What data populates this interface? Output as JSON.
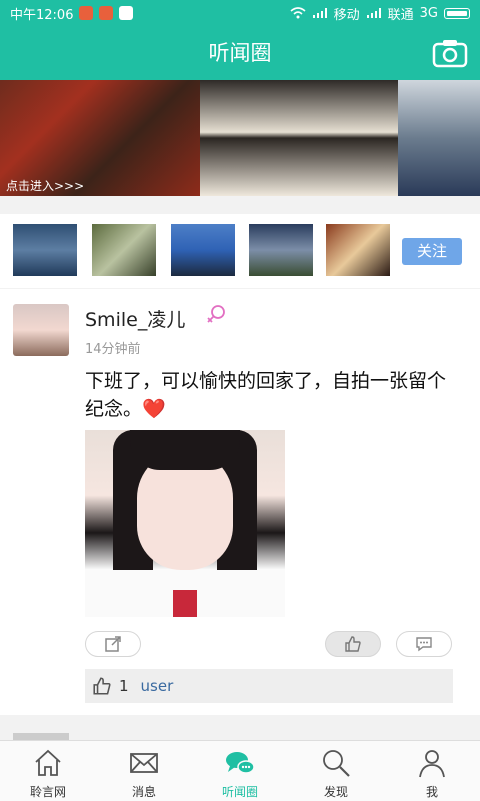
{
  "status": {
    "time": "中午12:06",
    "carrier1": "移动",
    "carrier2": "联通",
    "network": "3G"
  },
  "appbar": {
    "title": "听闻圈",
    "camera_icon": "camera-icon"
  },
  "banner": {
    "enter_text": "点击进入>>>"
  },
  "follow": {
    "button_label": "关注"
  },
  "post": {
    "username": "Smile_凌儿",
    "gender_icon": "female-icon",
    "time": "14分钟前",
    "text": "下班了，可以愉快的回家了，自拍一张留个纪念。",
    "emoji": "❤️",
    "likes": {
      "count": "1",
      "user": "user"
    }
  },
  "tabs": [
    {
      "label": "聆言网",
      "icon": "home-icon"
    },
    {
      "label": "消息",
      "icon": "mail-icon"
    },
    {
      "label": "听闻圈",
      "icon": "chat-bubbles-icon"
    },
    {
      "label": "发现",
      "icon": "search-icon"
    },
    {
      "label": "我",
      "icon": "person-icon"
    }
  ],
  "colors": {
    "accent": "#1fbfa3",
    "follow_button": "#6fa6e8",
    "link": "#3a6aa0"
  }
}
